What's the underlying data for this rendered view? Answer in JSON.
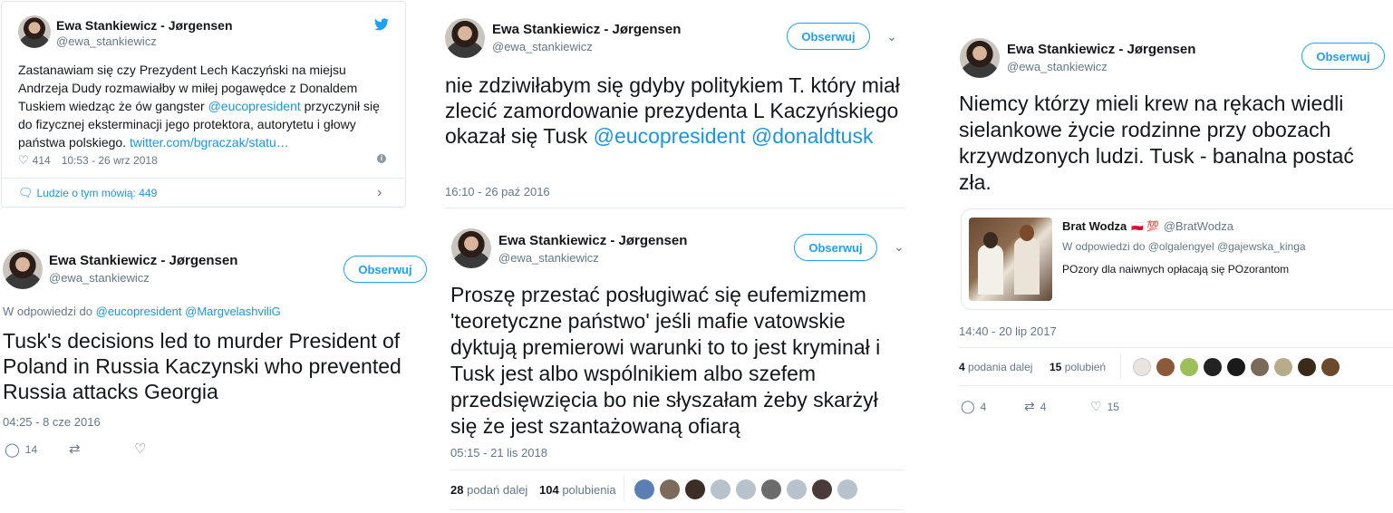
{
  "author": {
    "name": "Ewa Stankiewicz - Jørgensen",
    "handle": "@ewa_stankiewicz"
  },
  "follow_label": "Obserwuj",
  "embed": {
    "text": "Zastanawiam się czy Prezydent Lech Kaczyński na miejsu Andrzeja Dudy rozmawiałby w miłej pogawędce z Donaldem Tuskiem wiedząc że ów gangster ",
    "mention": "@eucopresident",
    "text2": " przyczynił się do fizycznej eksterminacji jego protektora, autorytetu i głowy państwa polskiego. ",
    "url": "twitter.com/bgraczak/statu…",
    "likes": "414",
    "time": "10:53 - 26 wrz 2018",
    "talk": "Ludzie o tym mówią: 449"
  },
  "tweet2": {
    "reply_prefix": "W odpowiedzi do",
    "reply_to1": "@eucopresident",
    "reply_to2": "@MargvelashviliG",
    "text": "Tusk's decisions led to murder President of Poland in Russia Kaczynski who prevented Russia attacks Georgia",
    "time": "04:25 - 8 cze 2016",
    "replies": "14"
  },
  "tweet3": {
    "text": "nie zdziwiłabym się gdyby politykiem T. który miał zlecić zamordowanie prezydenta L Kaczyńskiego okazał się Tusk ",
    "mention1": "@eucopresident",
    "mention2": "@donaldtusk",
    "time": "16:10 - 26 paź 2016"
  },
  "tweet4": {
    "text": "Proszę przestać posługiwać się eufemizmem 'teoretyczne państwo' jeśli mafie vatowskie dyktują premierowi warunki to to jest kryminał i Tusk jest albo wspólnikiem albo szefem przedsięwzięcia bo nie słyszałam żeby skarżył się że jest szantażowaną ofiarą",
    "time": "05:15 - 21 lis 2018",
    "retweets": "28",
    "retweets_label": "podań dalej",
    "likes": "104",
    "likes_label": "polubienia"
  },
  "tweet5": {
    "text": "Niemcy którzy mieli krew na rękach wiedli sielankowe życie rodzinne przy obozach krzywdzonych ludzi. Tusk - banalna postać zła.",
    "quote_name": "Brat Wodza",
    "quote_emoji": "🇵🇱 💯",
    "quote_handle": "@BratWodza",
    "quote_reply_prefix": "W odpowiedzi do",
    "quote_reply1": "@olgalengyel",
    "quote_reply2": "@gajewska_kinga",
    "quote_text": "POzory dla naiwnych opłacają się POzorantom",
    "time": "14:40 - 20 lip 2017",
    "retweets": "4",
    "retweets_label": "podania dalej",
    "likes": "15",
    "likes_label": "polubień",
    "replies": "4",
    "rt_count": "4",
    "like_count": "15"
  },
  "colors": {
    "accent": "#1da1f2",
    "link": "#1b95e0",
    "muted": "#657786"
  }
}
